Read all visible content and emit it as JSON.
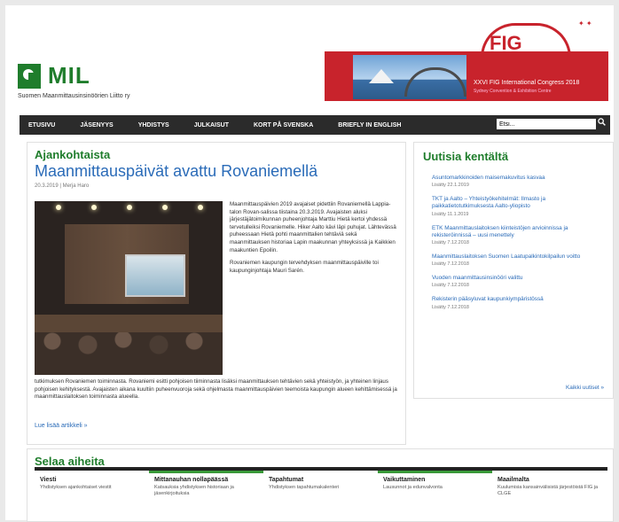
{
  "header": {
    "logo_text": "MIL",
    "logo_subtitle": "Suomen Maanmittausinsinöörien Liitto ry",
    "banner": {
      "title": "FIG",
      "line1": "XXVI FIG International Congress 2018",
      "line2": "Sydney Convention & Exhibition Centre"
    }
  },
  "nav": {
    "items": [
      "ETUSIVU",
      "JÄSENYYS",
      "YHDISTYS",
      "JULKAISUT",
      "KORT PÅ SVENSKA",
      "BRIEFLY IN ENGLISH"
    ],
    "search_value": "Etsi..."
  },
  "article": {
    "section": "Ajankohtaista",
    "title": "Maanmittauspäivät avattu Rovaniemellä",
    "meta": "20.3.2019 | Merja Haro",
    "para1": "Maanmittauspäivien 2019 avajaiset pidettiin Rovaniemellä Lappia-talon Rovan-salissa tiistaina 20.3.2019. Avajaisten aluksi järjestäjätoimikunnan puheenjohtaja Marttiu Hietä kertoi yhdessä tervetulleiksi Rovaniemelle. Hiker Aalto kävi läpi puhujat. Lähtevässä puheessaan Hietä pohti maanmittalien tehtäviä sekä maanmittauksen historiaa Lapin maakunnan yhteyksissä ja Kaikkien maakuntien Epoilin.",
    "para2": "Rovaniemen kaupungin tervehdyksen maanmittauspäiville toi kaupunginjohtaja Mauri Sarén.",
    "wide": "tutkimuksen Rovaniemen toiminnasta. Rovaniemi esitti pohjoisen tiiminnasta lisäksi maanmittauksen tehtävien sekä yhteistyön, ja yhteinen linjaus pohjoisen kehityksestä. Avajaisten aikana kuultiin puheenvuoroja sekä ohjelmasta maanmittauspäivien teemoista kaupungin alueen kehittämisessä ja maanmittauslaitoksen toiminnasta alueella.",
    "read_more": "Lue lisää artikkeli »"
  },
  "news": {
    "title": "Uutisia kentältä",
    "items": [
      {
        "text": "Asuntomarkkinoiden maisemakuvitus kasvaa",
        "date": "Lisätty 22.1.2019"
      },
      {
        "text": "TKT ja Aalto – Yhteistyökehitelmät: Ilmasto ja paikkatietotutkimuksesta Aalto-yliopisto",
        "date": "Lisätty 11.1.2019"
      },
      {
        "text": "ETK Maanmittauslaitoksen kiinteistöjen arvioinnissa ja rekisteröinnissä – uusi menettely",
        "date": "Lisätty 7.12.2018"
      },
      {
        "text": "Maanmittauslaitoksen Suomen Laatupalkintokilpailun voitto",
        "date": "Lisätty 7.12.2018"
      },
      {
        "text": "Vuoden maanmittausinsinööri valittu",
        "date": "Lisätty 7.12.2018"
      },
      {
        "text": "Rekisterin pääsyluvat kaupunkiympäristössä",
        "date": "Lisätty 7.12.2018"
      }
    ],
    "more": "Kaikki uutiset »"
  },
  "browse": {
    "title": "Selaa aiheita",
    "columns": [
      {
        "title": "Viesti",
        "text": "Yhdistyksen ajankohtaiset viestit"
      },
      {
        "title": "Mittanauhan nollapäässä",
        "text": "Katsauksia yhdistyksen historiaan ja jäsenkirjoituksia"
      },
      {
        "title": "Tapahtumat",
        "text": "Yhdistyksen tapahtumakalenteri"
      },
      {
        "title": "Vaikuttaminen",
        "text": "Lausunnot ja edunvalvonta"
      },
      {
        "title": "Maailmalta",
        "text": "Kuulumisia kansainvälisistä järjestöistä FIG ja CLGE"
      }
    ]
  }
}
